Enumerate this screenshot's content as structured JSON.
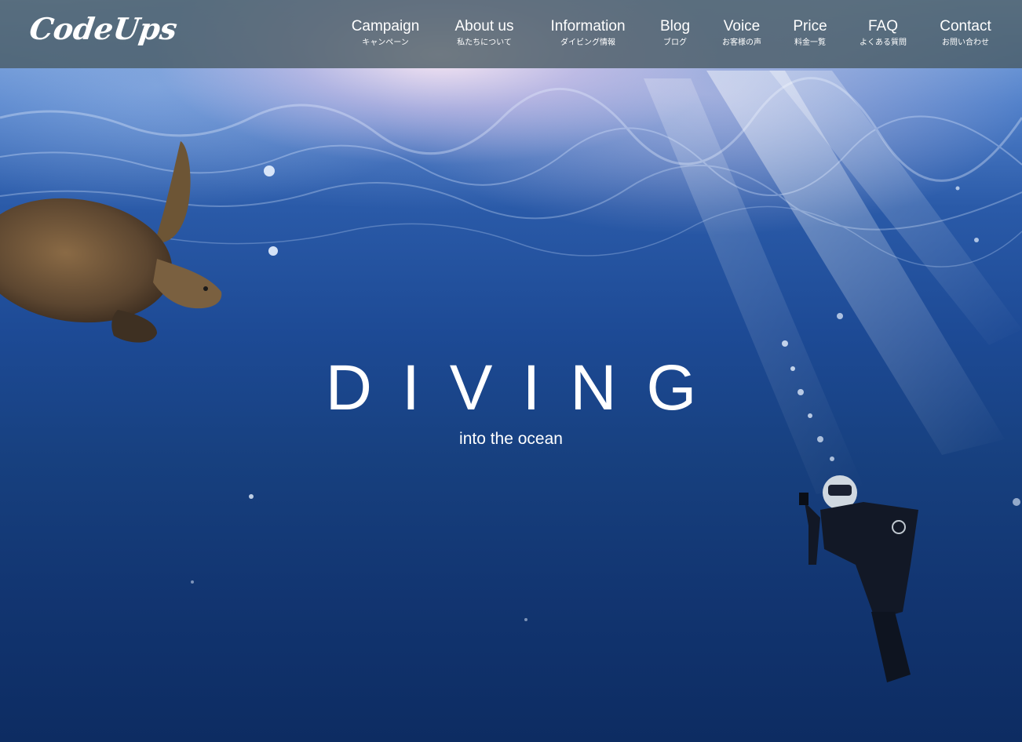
{
  "brand": {
    "logo_text": "CodeUps"
  },
  "nav": {
    "items": [
      {
        "label": "Campaign",
        "sub": "キャンペーン"
      },
      {
        "label": "About us",
        "sub": "私たちについて"
      },
      {
        "label": "Information",
        "sub": "ダイビング情報"
      },
      {
        "label": "Blog",
        "sub": "ブログ"
      },
      {
        "label": "Voice",
        "sub": "お客様の声"
      },
      {
        "label": "Price",
        "sub": "料金一覧"
      },
      {
        "label": "FAQ",
        "sub": "よくある質問"
      },
      {
        "label": "Contact",
        "sub": "お問い合わせ"
      }
    ]
  },
  "hero": {
    "title": "DIVING",
    "subtitle": "into the ocean",
    "image_subjects": [
      "sea-turtle",
      "scuba-diver",
      "water-surface",
      "bubbles"
    ]
  },
  "colors": {
    "header_bg": "#485A62",
    "text": "#FFFFFF",
    "water_deep": "#0D2C62",
    "water_light": "#8FB3E6"
  }
}
